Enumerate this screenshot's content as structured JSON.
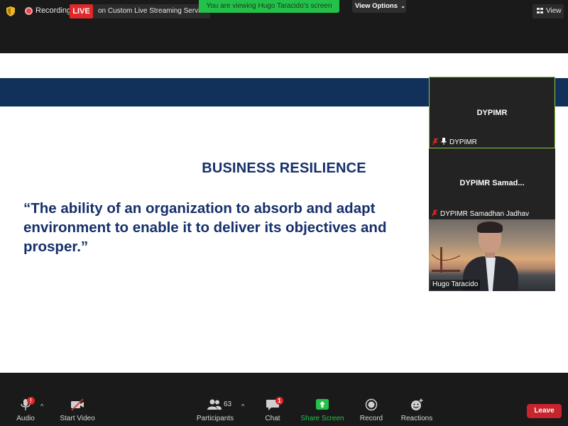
{
  "topbar": {
    "recording_label": "Recording",
    "live_badge": "LIVE",
    "stream_label": "on Custom Live Streaming Service",
    "viewing_banner": "You are viewing Hugo Taracido's screen",
    "view_options": "View Options",
    "view_label": "View"
  },
  "slide": {
    "title": "BUSINESS RESILIENCE",
    "quote": "“The ability of an organization to absorb and adapt\nenvironment to enable it to deliver its objectives and\nprosper.”"
  },
  "participants_panel": [
    {
      "center_name": "DYPIMR",
      "footer_name": "DYPIMR",
      "muted": true,
      "pinned": true,
      "active_speaker": true
    },
    {
      "center_name": "DYPIMR  Samad...",
      "footer_name": "DYPIMR Samadhan Jadhav",
      "muted": true,
      "pinned": false,
      "active_speaker": false
    },
    {
      "center_name": "",
      "footer_name": "Hugo Taracido",
      "muted": false,
      "pinned": false,
      "active_speaker": false,
      "has_video": true
    }
  ],
  "toolbar": {
    "audio": {
      "label": "Audio",
      "badge": "!"
    },
    "video": {
      "label": "Start Video"
    },
    "participants": {
      "label": "Participants",
      "count": "63"
    },
    "chat": {
      "label": "Chat",
      "badge": "1"
    },
    "share": {
      "label": "Share Screen"
    },
    "record": {
      "label": "Record"
    },
    "reactions": {
      "label": "Reactions"
    },
    "leave": {
      "label": "Leave"
    }
  },
  "colors": {
    "live_red": "#e02828",
    "share_green": "#23c14a",
    "slide_navy": "#15306b",
    "leave_red": "#c7242b"
  },
  "icons": [
    "shield-icon",
    "recording-dot-icon",
    "chevron-down-icon",
    "grid-view-icon",
    "mic-muted-icon",
    "pin-icon",
    "microphone-icon",
    "video-off-icon",
    "participants-icon",
    "chat-icon",
    "share-screen-icon",
    "record-icon",
    "reactions-icon"
  ]
}
